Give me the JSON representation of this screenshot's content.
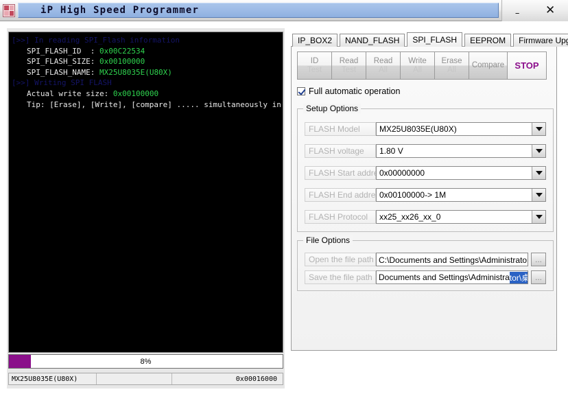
{
  "window": {
    "title": "iP High Speed Programmer",
    "icon": "app-grid-icon",
    "minimize_label": "–",
    "close_label": "✕"
  },
  "console": {
    "lines": [
      {
        "type": "head",
        "text": "[>>] In reading SPI_Flash information"
      },
      {
        "type": "kv",
        "label": "SPI_FLASH_ID  :",
        "value": "0x00C22534"
      },
      {
        "type": "kv",
        "label": "SPI_FLASH_SIZE:",
        "value": "0x00100000"
      },
      {
        "type": "kv",
        "label": "SPI_FLASH_NAME:",
        "value": "MX25U8035E(U80X)"
      },
      {
        "type": "head",
        "text": "[>>] Writing SPI FLASH"
      },
      {
        "type": "kv",
        "label": "Actual write size:",
        "value": "0x00100000"
      },
      {
        "type": "plain",
        "text": "Tip: [Erase], [Write], [compare] ..... simultaneously in"
      }
    ]
  },
  "progress": {
    "percent": 8,
    "label": "8%",
    "fill_color": "#8a0f8a"
  },
  "statusbar": {
    "chip": "MX25U8035E(U80X)",
    "middle": "",
    "address": "0x00016000"
  },
  "tabs": [
    {
      "label": "IP_BOX2",
      "active": false
    },
    {
      "label": "NAND_FLASH",
      "active": false
    },
    {
      "label": "SPI_FLASH",
      "active": true
    },
    {
      "label": "EEPROM",
      "active": false
    },
    {
      "label": "Firmware Upgrade",
      "active": false
    }
  ],
  "actions": [
    {
      "line1": "ID",
      "line2": "Test",
      "enabled": false
    },
    {
      "line1": "Read",
      "line2": "Test",
      "enabled": false
    },
    {
      "line1": "Read",
      "line2": "All",
      "enabled": false
    },
    {
      "line1": "Write",
      "line2": "All",
      "enabled": false
    },
    {
      "line1": "Erase",
      "line2": "All",
      "enabled": false
    },
    {
      "line1": "Compare",
      "line2": "",
      "enabled": false
    },
    {
      "line1": "STOP",
      "line2": "",
      "enabled": true
    }
  ],
  "auto_checkbox": {
    "label": "Full automatic operation",
    "checked": true
  },
  "setup": {
    "title": "Setup Options",
    "fields": [
      {
        "label": "FLASH Model",
        "value": "MX25U8035E(U80X)"
      },
      {
        "label": "FLASH voltage",
        "value": "1.80 V"
      },
      {
        "label": "FLASH Start address",
        "value": "0x00000000"
      },
      {
        "label": "FLASH End address",
        "value": "0x00100000->  1M"
      },
      {
        "label": "FLASH Protocol",
        "value": "xx25_xx26_xx_0"
      }
    ]
  },
  "file_options": {
    "title": "File Options",
    "open": {
      "label": "Open the file path",
      "value": "C:\\Documents and Settings\\Administrator\\桌面\\A",
      "browse_label": "..."
    },
    "save": {
      "label": "Save the file path",
      "value_plain": "Documents and Settings\\Administra",
      "value_selected": "tor\\桌面\\AAA",
      "browse_label": "..."
    }
  },
  "colors": {
    "accent_purple": "#8a0f8a",
    "selection_blue": "#2a62c4",
    "console_value_green": "#2fd44f",
    "console_head_blue": "#141466"
  }
}
